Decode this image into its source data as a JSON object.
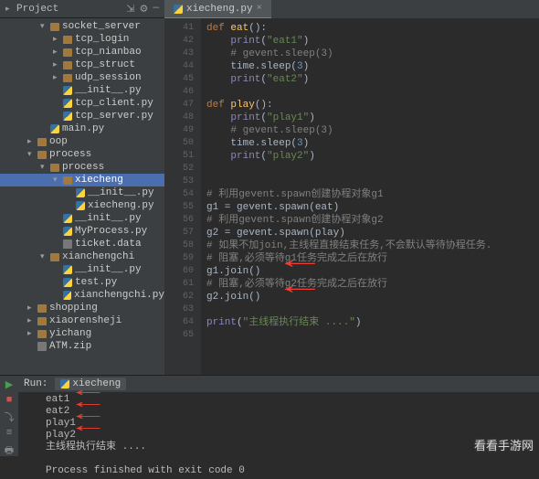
{
  "header": {
    "project_label": "Project",
    "tab_file": "xiecheng.py",
    "tab_close": "×"
  },
  "sidebar": [
    {
      "ind": 2,
      "chev": "▾",
      "icon": "folder",
      "label": "socket_server",
      "dim": true
    },
    {
      "ind": 3,
      "chev": "▸",
      "icon": "folder",
      "label": "tcp_login"
    },
    {
      "ind": 3,
      "chev": "▸",
      "icon": "folder",
      "label": "tcp_nianbao"
    },
    {
      "ind": 3,
      "chev": "▸",
      "icon": "folder",
      "label": "tcp_struct"
    },
    {
      "ind": 3,
      "chev": "▸",
      "icon": "folder",
      "label": "udp_session"
    },
    {
      "ind": 3,
      "chev": "",
      "icon": "py",
      "label": "__init__.py"
    },
    {
      "ind": 3,
      "chev": "",
      "icon": "py",
      "label": "tcp_client.py"
    },
    {
      "ind": 3,
      "chev": "",
      "icon": "py",
      "label": "tcp_server.py"
    },
    {
      "ind": 2,
      "chev": "",
      "icon": "py",
      "label": "main.py"
    },
    {
      "ind": 1,
      "chev": "▸",
      "icon": "folder",
      "label": "oop"
    },
    {
      "ind": 1,
      "chev": "▾",
      "icon": "folder",
      "label": "process"
    },
    {
      "ind": 2,
      "chev": "▾",
      "icon": "folder",
      "label": "process"
    },
    {
      "ind": 3,
      "chev": "▾",
      "icon": "folder",
      "label": "xiecheng",
      "sel": true
    },
    {
      "ind": 4,
      "chev": "",
      "icon": "py",
      "label": "__init__.py"
    },
    {
      "ind": 4,
      "chev": "",
      "icon": "py",
      "label": "xiecheng.py"
    },
    {
      "ind": 3,
      "chev": "",
      "icon": "py",
      "label": "__init__.py"
    },
    {
      "ind": 3,
      "chev": "",
      "icon": "py",
      "label": "MyProcess.py"
    },
    {
      "ind": 3,
      "chev": "",
      "icon": "file",
      "label": "ticket.data"
    },
    {
      "ind": 2,
      "chev": "▾",
      "icon": "folder",
      "label": "xianchengchi"
    },
    {
      "ind": 3,
      "chev": "",
      "icon": "py",
      "label": "__init__.py"
    },
    {
      "ind": 3,
      "chev": "",
      "icon": "py",
      "label": "test.py"
    },
    {
      "ind": 3,
      "chev": "",
      "icon": "py",
      "label": "xianchengchi.py"
    },
    {
      "ind": 1,
      "chev": "▸",
      "icon": "folder",
      "label": "shopping"
    },
    {
      "ind": 1,
      "chev": "▸",
      "icon": "folder",
      "label": "xiaorensheji"
    },
    {
      "ind": 1,
      "chev": "▸",
      "icon": "folder",
      "label": "yichang"
    },
    {
      "ind": 1,
      "chev": "",
      "icon": "file",
      "label": "ATM.zip"
    }
  ],
  "gutter_start": 41,
  "code": [
    {
      "t": "def ",
      "cls": "kw",
      "cont": [
        {
          "t": "eat",
          "cls": "fn"
        },
        {
          "t": "():"
        }
      ]
    },
    {
      "pad": 4,
      "parts": [
        {
          "t": "print",
          "cls": "builtin"
        },
        {
          "t": "("
        },
        {
          "t": "\"eat1\"",
          "cls": "str"
        },
        {
          "t": ")"
        }
      ]
    },
    {
      "pad": 4,
      "parts": [
        {
          "t": "# gevent.sleep(3)",
          "cls": "cm"
        }
      ]
    },
    {
      "pad": 4,
      "parts": [
        {
          "t": "time.sleep("
        },
        {
          "t": "3",
          "cls": "num"
        },
        {
          "t": ")"
        }
      ]
    },
    {
      "pad": 4,
      "parts": [
        {
          "t": "print",
          "cls": "builtin"
        },
        {
          "t": "("
        },
        {
          "t": "\"eat2\"",
          "cls": "str"
        },
        {
          "t": ")"
        }
      ]
    },
    {
      "blank": true
    },
    {
      "t": "def ",
      "cls": "kw",
      "cont": [
        {
          "t": "play",
          "cls": "fn"
        },
        {
          "t": "():"
        }
      ]
    },
    {
      "pad": 4,
      "parts": [
        {
          "t": "print",
          "cls": "builtin"
        },
        {
          "t": "("
        },
        {
          "t": "\"play1\"",
          "cls": "str"
        },
        {
          "t": ")"
        }
      ]
    },
    {
      "pad": 4,
      "parts": [
        {
          "t": "# gevent.sleep(3)",
          "cls": "cm"
        }
      ]
    },
    {
      "pad": 4,
      "parts": [
        {
          "t": "time.sleep("
        },
        {
          "t": "3",
          "cls": "num"
        },
        {
          "t": ")"
        }
      ]
    },
    {
      "pad": 4,
      "parts": [
        {
          "t": "print",
          "cls": "builtin"
        },
        {
          "t": "("
        },
        {
          "t": "\"play2\"",
          "cls": "str"
        },
        {
          "t": ")"
        }
      ]
    },
    {
      "blank": true
    },
    {
      "blank": true
    },
    {
      "pad": 0,
      "parts": [
        {
          "t": "# 利用gevent.spawn创建协程对象g1",
          "cls": "cm"
        }
      ]
    },
    {
      "pad": 0,
      "parts": [
        {
          "t": "g1 = gevent.spawn(eat)"
        }
      ]
    },
    {
      "pad": 0,
      "parts": [
        {
          "t": "# 利用gevent.spawn创建协程对象g2",
          "cls": "cm"
        }
      ]
    },
    {
      "pad": 0,
      "parts": [
        {
          "t": "g2 = gevent.spawn(play)"
        }
      ]
    },
    {
      "pad": 0,
      "parts": [
        {
          "t": "# 如果不加join,主线程直接结束任务,不会默认等待协程任务.",
          "cls": "cm"
        }
      ]
    },
    {
      "pad": 0,
      "parts": [
        {
          "t": "# 阻塞,必须等待g1任务完成之后在放行",
          "cls": "cm"
        }
      ]
    },
    {
      "pad": 0,
      "parts": [
        {
          "t": "g1.join()"
        }
      ],
      "arrow": true
    },
    {
      "pad": 0,
      "parts": [
        {
          "t": "# 阻塞,必须等待g2任务完成之后在放行",
          "cls": "cm"
        }
      ]
    },
    {
      "pad": 0,
      "parts": [
        {
          "t": "g2.join()"
        }
      ],
      "arrow": true
    },
    {
      "blank": true
    },
    {
      "pad": 0,
      "parts": [
        {
          "t": "print",
          "cls": "builtin"
        },
        {
          "t": "("
        },
        {
          "t": "\"主线程执行结束 ....\"",
          "cls": "str"
        },
        {
          "t": ")"
        }
      ]
    },
    {
      "blank": true
    }
  ],
  "run": {
    "label": "Run:",
    "tab": "xiecheng",
    "lines": [
      "eat1",
      "eat2",
      "play1",
      "play2",
      "主线程执行结束 ....",
      "",
      "Process finished with exit code 0"
    ],
    "arrows": [
      0,
      1,
      2,
      3
    ]
  },
  "watermark": "看看手游网"
}
